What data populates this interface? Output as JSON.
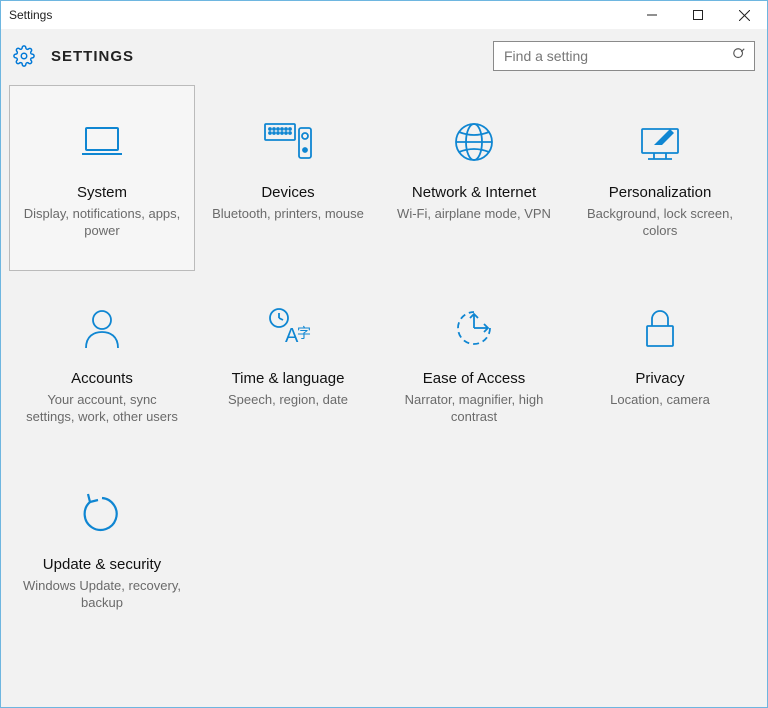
{
  "window": {
    "title": "Settings"
  },
  "header": {
    "title": "SETTINGS"
  },
  "search": {
    "placeholder": "Find a setting"
  },
  "tiles": [
    {
      "title": "System",
      "subtitle": "Display, notifications, apps, power",
      "selected": true,
      "name": "tile-system",
      "icon": "laptop-icon"
    },
    {
      "title": "Devices",
      "subtitle": "Bluetooth, printers, mouse",
      "selected": false,
      "name": "tile-devices",
      "icon": "devices-icon"
    },
    {
      "title": "Network & Internet",
      "subtitle": "Wi-Fi, airplane mode, VPN",
      "selected": false,
      "name": "tile-network",
      "icon": "globe-icon"
    },
    {
      "title": "Personalization",
      "subtitle": "Background, lock screen, colors",
      "selected": false,
      "name": "tile-personalization",
      "icon": "personalization-icon"
    },
    {
      "title": "Accounts",
      "subtitle": "Your account, sync settings, work, other users",
      "selected": false,
      "name": "tile-accounts",
      "icon": "person-icon"
    },
    {
      "title": "Time & language",
      "subtitle": "Speech, region, date",
      "selected": false,
      "name": "tile-time-language",
      "icon": "time-language-icon"
    },
    {
      "title": "Ease of Access",
      "subtitle": "Narrator, magnifier, high contrast",
      "selected": false,
      "name": "tile-ease-of-access",
      "icon": "ease-of-access-icon"
    },
    {
      "title": "Privacy",
      "subtitle": "Location, camera",
      "selected": false,
      "name": "tile-privacy",
      "icon": "lock-icon"
    },
    {
      "title": "Update & security",
      "subtitle": "Windows Update, recovery, backup",
      "selected": false,
      "name": "tile-update-security",
      "icon": "refresh-icon"
    }
  ]
}
